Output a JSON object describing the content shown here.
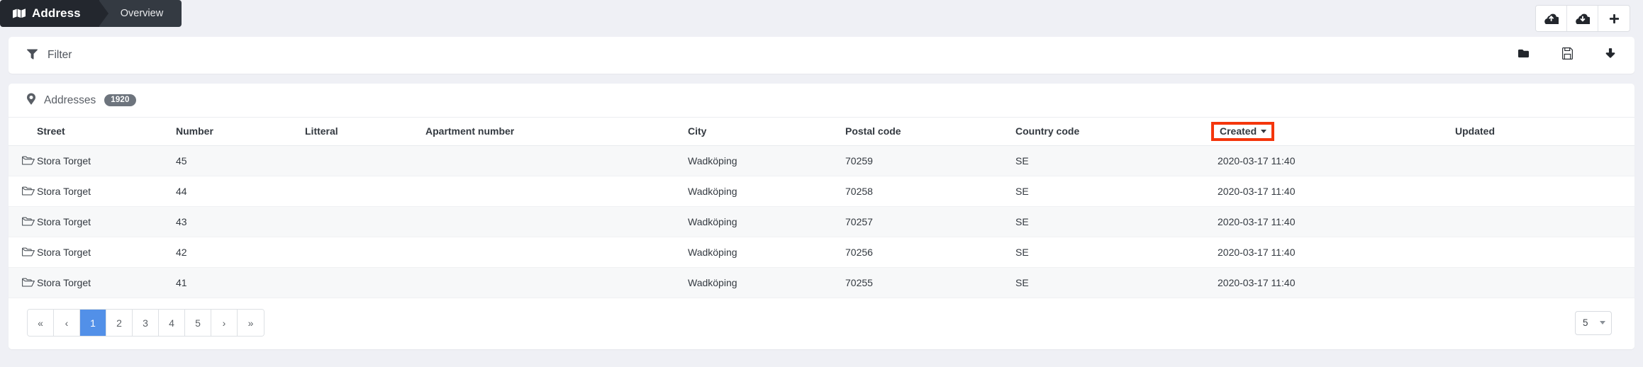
{
  "breadcrumb": {
    "icon": "map-icon",
    "primary": "Address",
    "secondary": "Overview"
  },
  "topbar": {
    "actions": [
      {
        "name": "cloud-upload-button",
        "icon": "cloud-upload-icon"
      },
      {
        "name": "cloud-download-button",
        "icon": "cloud-download-icon"
      },
      {
        "name": "add-button",
        "icon": "plus-icon"
      }
    ]
  },
  "filter": {
    "icon": "filter-icon",
    "label": "Filter",
    "actions": [
      {
        "name": "open-folder-button",
        "icon": "folder-icon"
      },
      {
        "name": "save-button",
        "icon": "floppy-disk-icon"
      },
      {
        "name": "download-button",
        "icon": "download-arrow-icon"
      }
    ]
  },
  "table": {
    "icon": "map-pin-icon",
    "title": "Addresses",
    "count": "1920",
    "sorted_column": "Created",
    "sort_direction": "desc",
    "sort_highlight_color": "#f4360c",
    "columns": [
      "Street",
      "Number",
      "Litteral",
      "Apartment number",
      "City",
      "Postal code",
      "Country code",
      "Created",
      "Updated"
    ],
    "rows": [
      {
        "row_icon": "open-folder-icon",
        "street": "Stora Torget",
        "number": "45",
        "litteral": "",
        "apartment_number": "",
        "city": "Wadköping",
        "postal_code": "70259",
        "country_code": "SE",
        "created": "2020-03-17 11:40",
        "updated": ""
      },
      {
        "row_icon": "open-folder-icon",
        "street": "Stora Torget",
        "number": "44",
        "litteral": "",
        "apartment_number": "",
        "city": "Wadköping",
        "postal_code": "70258",
        "country_code": "SE",
        "created": "2020-03-17 11:40",
        "updated": ""
      },
      {
        "row_icon": "open-folder-icon",
        "street": "Stora Torget",
        "number": "43",
        "litteral": "",
        "apartment_number": "",
        "city": "Wadköping",
        "postal_code": "70257",
        "country_code": "SE",
        "created": "2020-03-17 11:40",
        "updated": ""
      },
      {
        "row_icon": "open-folder-icon",
        "street": "Stora Torget",
        "number": "42",
        "litteral": "",
        "apartment_number": "",
        "city": "Wadköping",
        "postal_code": "70256",
        "country_code": "SE",
        "created": "2020-03-17 11:40",
        "updated": ""
      },
      {
        "row_icon": "open-folder-icon",
        "street": "Stora Torget",
        "number": "41",
        "litteral": "",
        "apartment_number": "",
        "city": "Wadköping",
        "postal_code": "70255",
        "country_code": "SE",
        "created": "2020-03-17 11:40",
        "updated": ""
      }
    ]
  },
  "pagination": {
    "first": "«",
    "prev": "‹",
    "pages": [
      "1",
      "2",
      "3",
      "4",
      "5"
    ],
    "active_page": "1",
    "next": "›",
    "last": "»",
    "active_color": "#5290e8",
    "page_size": "5"
  }
}
